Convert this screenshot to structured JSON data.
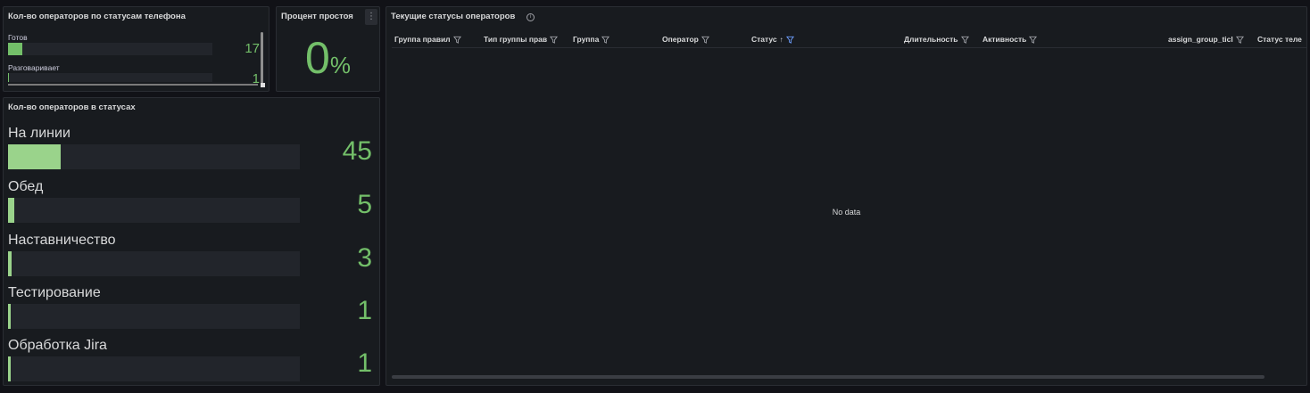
{
  "phone_status_panel": {
    "title": "Кол-во операторов по статусам телефона",
    "rows": [
      {
        "label": "Готов",
        "value": "17",
        "fill": 0.07
      },
      {
        "label": "Разговаривает",
        "value": "1",
        "fill": 0.005
      }
    ]
  },
  "idle_panel": {
    "title": "Процент простоя",
    "menu_icon": "kebab-menu-icon",
    "value": "0",
    "unit": "%"
  },
  "status_count_panel": {
    "title": "Кол-во операторов в статусах",
    "rows": [
      {
        "label": "На линии",
        "value": "45",
        "fill": 0.18
      },
      {
        "label": "Обед",
        "value": "5",
        "fill": 0.02
      },
      {
        "label": "Наставничество",
        "value": "3",
        "fill": 0.012
      },
      {
        "label": "Тестирование",
        "value": "1",
        "fill": 0.004
      },
      {
        "label": "Обработка Jira",
        "value": "1",
        "fill": 0.004
      }
    ]
  },
  "current_status_panel": {
    "title": "Текущие статусы операторов",
    "info_icon": "info-icon",
    "columns": [
      {
        "label": "Группа правил",
        "filter": true
      },
      {
        "label": "Тип группы прав",
        "filter": true
      },
      {
        "label": "Группа",
        "filter": true
      },
      {
        "label": "Оператор",
        "filter": true
      },
      {
        "label": "Статус",
        "filter": true,
        "sort": "↑",
        "filter_active": true
      },
      {
        "label": "Длительность",
        "filter": true
      },
      {
        "label": "Активность",
        "filter": true
      },
      {
        "label": "assign_group_ticl",
        "filter": true
      },
      {
        "label": "Статус теле",
        "filter": false
      }
    ],
    "empty_text": "No data"
  },
  "colors": {
    "accent_green": "#73bf69",
    "filter_active": "#6e9fff",
    "background": "#111217",
    "panel": "#181b1f"
  }
}
